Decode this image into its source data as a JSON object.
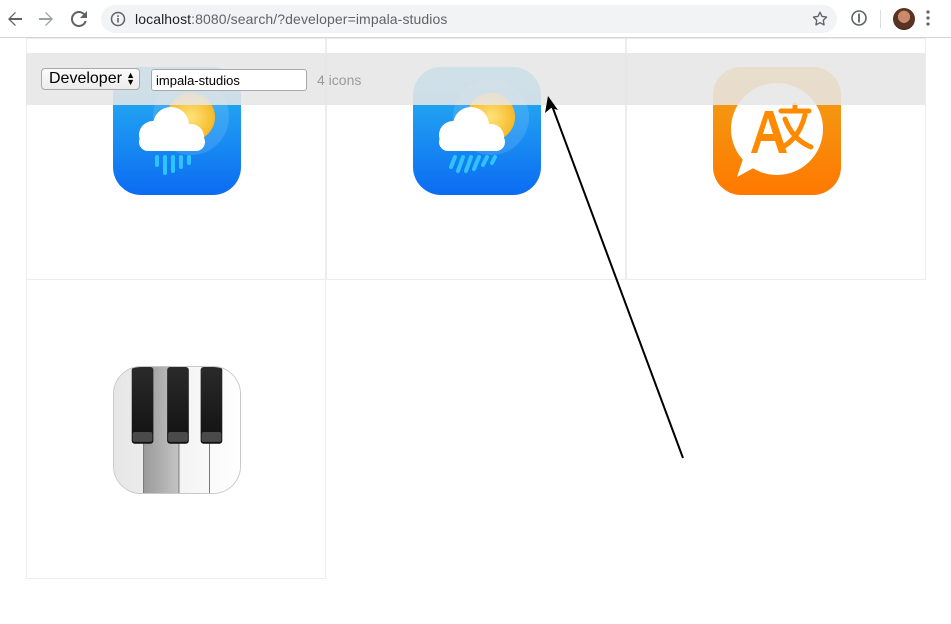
{
  "browser": {
    "url_host": "localhost",
    "url_rest": ":8080/search/?developer=impala-studios",
    "back_icon": "arrow-left-icon",
    "forward_icon": "arrow-right-icon",
    "reload_icon": "reload-icon",
    "info_icon": "info-circle-icon",
    "star_icon": "star-icon"
  },
  "toolbar": {
    "filter_select_value": "Developer",
    "search_value": "impala-studios",
    "result_count": "4 icons"
  },
  "icons": [
    {
      "name": "weather-rain-icon",
      "style": "weather"
    },
    {
      "name": "weather-rain-icon",
      "style": "weather"
    },
    {
      "name": "translate-icon",
      "style": "translate"
    },
    {
      "name": "piano-icon",
      "style": "piano"
    }
  ],
  "colors": {
    "weather_top": "#27b4f0",
    "weather_bottom": "#0a6ff2",
    "translate_top": "#f2a31a",
    "translate_bottom": "#ff7b00",
    "toolbar_bg": "#e6e6e6"
  }
}
